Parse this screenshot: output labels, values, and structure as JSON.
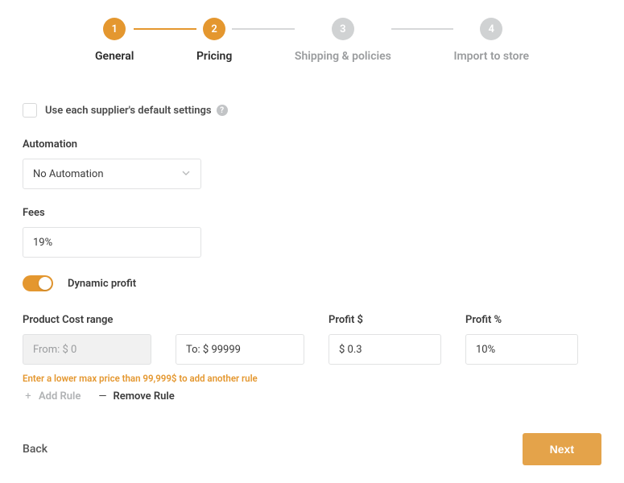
{
  "stepper": {
    "steps": [
      {
        "num": "1",
        "label": "General",
        "state": "active"
      },
      {
        "num": "2",
        "label": "Pricing",
        "state": "active"
      },
      {
        "num": "3",
        "label": "Shipping & policies",
        "state": "inactive"
      },
      {
        "num": "4",
        "label": "Import to store",
        "state": "inactive"
      }
    ]
  },
  "checkbox": {
    "label": "Use each supplier's default settings"
  },
  "automation": {
    "label": "Automation",
    "value": "No Automation"
  },
  "fees": {
    "label": "Fees",
    "value": "19%"
  },
  "dynamic_profit": {
    "label": "Dynamic profit"
  },
  "range": {
    "header": "Product Cost range",
    "from_placeholder": "From: $ 0",
    "to_value": "To: $ 99999"
  },
  "profit_dollar": {
    "header": "Profit $",
    "value": "$ 0.3"
  },
  "profit_percent": {
    "header": "Profit %",
    "value": "10%"
  },
  "hint": "Enter a lower max price than 99,999$ to add another rule",
  "rule_actions": {
    "add": "Add Rule",
    "remove": "Remove Rule"
  },
  "footer": {
    "back": "Back",
    "next": "Next"
  }
}
